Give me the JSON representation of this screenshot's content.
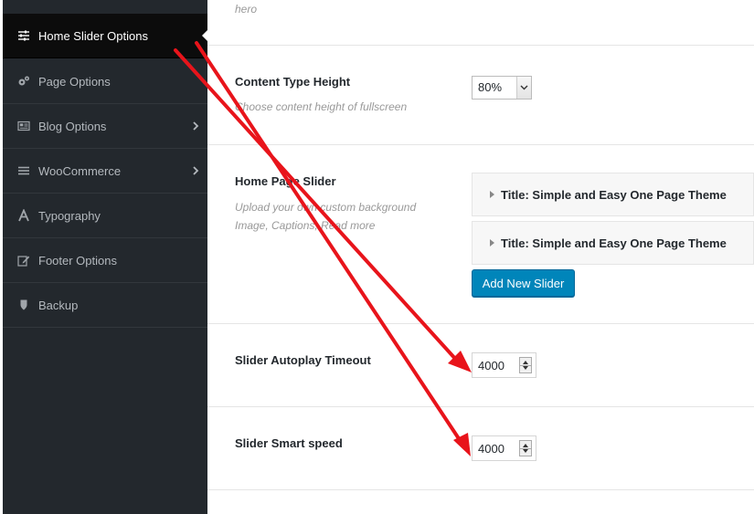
{
  "sidebar": {
    "items": [
      {
        "label": "Home Slider Options",
        "icon": "sliders-icon",
        "active": true
      },
      {
        "label": "Page Options",
        "icon": "gears-icon"
      },
      {
        "label": "Blog Options",
        "icon": "newspaper-icon",
        "has_submenu": true
      },
      {
        "label": "WooCommerce",
        "icon": "list-icon",
        "has_submenu": true
      },
      {
        "label": "Typography",
        "icon": "font-icon"
      },
      {
        "label": "Footer Options",
        "icon": "edit-icon"
      },
      {
        "label": "Backup",
        "icon": "shield-icon"
      }
    ]
  },
  "main": {
    "top_desc": "hero",
    "content_type_height": {
      "label": "Content Type Height",
      "description": "Choose content height of fullscreen",
      "value": "80%"
    },
    "home_page_slider": {
      "label": "Home Page Slider",
      "description": "Upload your own custom background Image, Captions, Read more",
      "slides": [
        {
          "title": "Title: Simple and Easy One Page Theme"
        },
        {
          "title": "Title: Simple and Easy One Page Theme"
        }
      ],
      "add_button": "Add New Slider"
    },
    "slider_autoplay_timeout": {
      "label": "Slider Autoplay Timeout",
      "value": "4000"
    },
    "slider_smart_speed": {
      "label": "Slider Smart speed",
      "value": "4000"
    }
  },
  "colors": {
    "sidebar_bg": "#23282d",
    "sidebar_active_bg": "#0c0c0c",
    "button_blue": "#0085ba",
    "annotation_arrow": "#e8141b"
  }
}
